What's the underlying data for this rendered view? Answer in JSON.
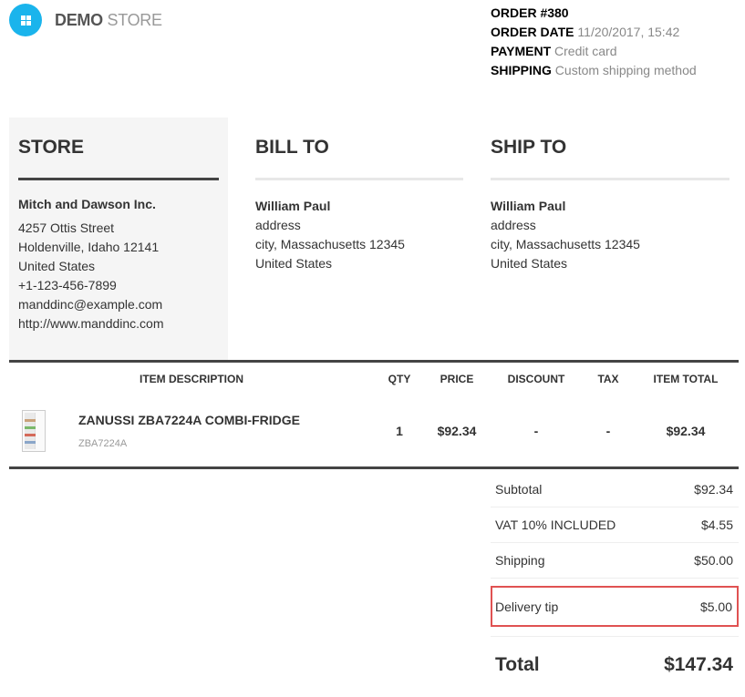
{
  "logo": {
    "brand_bold": "DEMO",
    "brand_light": "STORE",
    "accent_color": "#1ab4ec"
  },
  "order": {
    "number_label": "ORDER #380",
    "date_label": "ORDER DATE",
    "date_value": "11/20/2017, 15:42",
    "payment_label": "PAYMENT",
    "payment_value": "Credit card",
    "shipping_label": "SHIPPING",
    "shipping_value": "Custom shipping method"
  },
  "store": {
    "heading": "STORE",
    "name": "Mitch and Dawson Inc.",
    "lines": [
      "4257 Ottis Street",
      "Holdenville, Idaho 12141",
      "United States",
      "+1-123-456-7899",
      "manddinc@example.com",
      "http://www.manddinc.com"
    ]
  },
  "bill_to": {
    "heading": "BILL TO",
    "name": "William Paul",
    "lines": [
      "address",
      "city, Massachusetts 12345",
      "United States"
    ]
  },
  "ship_to": {
    "heading": "SHIP TO",
    "name": "William Paul",
    "lines": [
      "address",
      "city, Massachusetts 12345",
      "United States"
    ]
  },
  "items": {
    "headers": {
      "description": "ITEM DESCRIPTION",
      "qty": "QTY",
      "price": "PRICE",
      "discount": "DISCOUNT",
      "tax": "TAX",
      "total": "ITEM TOTAL"
    },
    "rows": [
      {
        "name": "ZANUSSI ZBA7224A COMBI-FRIDGE",
        "sku": "ZBA7224A",
        "qty": "1",
        "price": "$92.34",
        "discount": "-",
        "tax": "-",
        "total": "$92.34"
      }
    ]
  },
  "totals": {
    "subtotal_label": "Subtotal",
    "subtotal_value": "$92.34",
    "vat_label": "VAT 10% INCLUDED",
    "vat_value": "$4.55",
    "shipping_label": "Shipping",
    "shipping_value": "$50.00",
    "tip_label": "Delivery tip",
    "tip_value": "$5.00",
    "total_label": "Total",
    "total_value": "$147.34",
    "highlight_color": "#e05252"
  }
}
